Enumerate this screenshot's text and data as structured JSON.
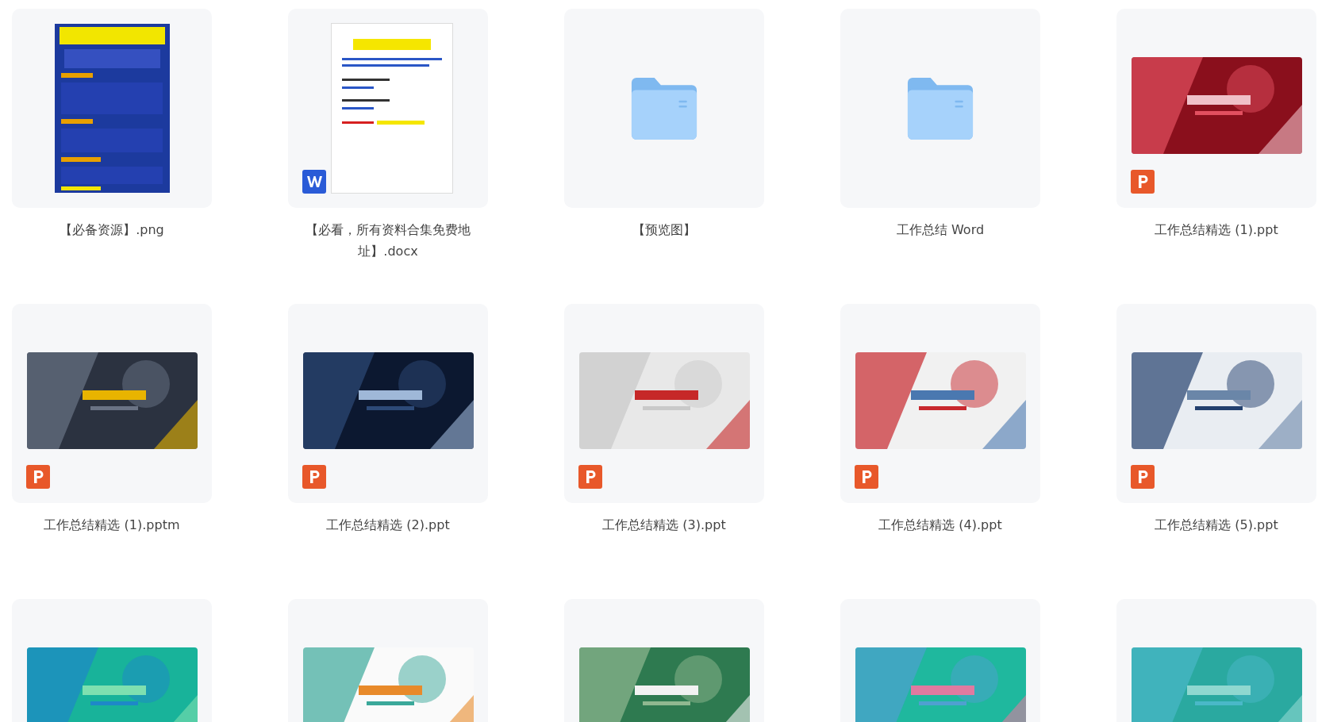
{
  "files": [
    {
      "name": "【必备资源】.png"
    },
    {
      "name": "【必看，所有资料合集免费地址】.docx",
      "kind": "word"
    },
    {
      "name": "【预览图】",
      "kind": "folder"
    },
    {
      "name": "工作总结 Word",
      "kind": "folder"
    },
    {
      "name": "工作总结精选 (1).ppt",
      "kind": "ppt"
    },
    {
      "name": "工作总结精选 (1).pptm",
      "kind": "ppt"
    },
    {
      "name": "工作总结精选 (2).ppt",
      "kind": "ppt"
    },
    {
      "name": "工作总结精选 (3).ppt",
      "kind": "ppt"
    },
    {
      "name": "工作总结精选 (4).ppt",
      "kind": "ppt"
    },
    {
      "name": "工作总结精选 (5).ppt",
      "kind": "ppt"
    },
    {
      "kind": "ppt"
    },
    {
      "kind": "ppt"
    },
    {
      "kind": "ppt"
    },
    {
      "kind": "ppt"
    },
    {
      "kind": "ppt"
    }
  ]
}
